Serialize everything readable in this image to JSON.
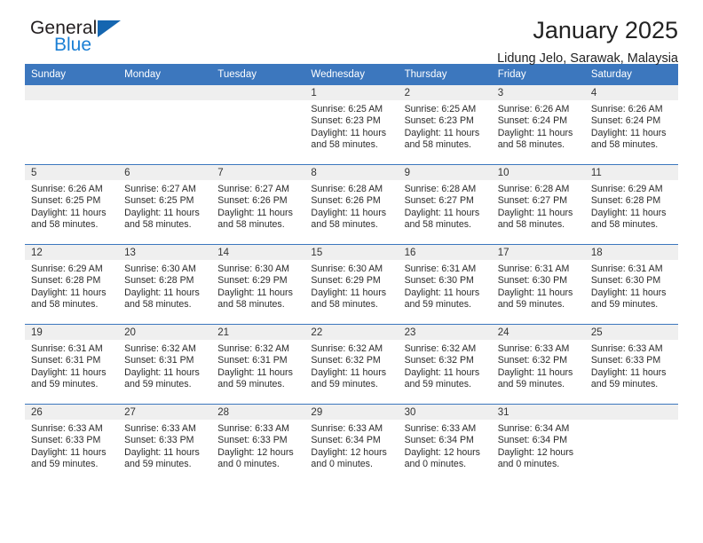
{
  "logo": {
    "word_top": "General",
    "word_bottom": "Blue",
    "triangle_color": "#1566b0",
    "blue_color": "#1b7fd4"
  },
  "header": {
    "title": "January 2025",
    "subtitle": "Lidung Jelo, Sarawak, Malaysia"
  },
  "theme": {
    "header_blue": "#3c77be",
    "daynum_band": "#efefef",
    "text": "#222222"
  },
  "weekday_headers": [
    "Sunday",
    "Monday",
    "Tuesday",
    "Wednesday",
    "Thursday",
    "Friday",
    "Saturday"
  ],
  "labels": {
    "sunrise_prefix": "Sunrise:",
    "sunset_prefix": "Sunset:",
    "daylight_prefix": "Daylight:"
  },
  "weeks": [
    [
      {
        "day": "",
        "empty": true
      },
      {
        "day": "",
        "empty": true
      },
      {
        "day": "",
        "empty": true
      },
      {
        "day": "1",
        "sunrise": "Sunrise: 6:25 AM",
        "sunset": "Sunset: 6:23 PM",
        "daylight": "Daylight: 11 hours and 58 minutes."
      },
      {
        "day": "2",
        "sunrise": "Sunrise: 6:25 AM",
        "sunset": "Sunset: 6:23 PM",
        "daylight": "Daylight: 11 hours and 58 minutes."
      },
      {
        "day": "3",
        "sunrise": "Sunrise: 6:26 AM",
        "sunset": "Sunset: 6:24 PM",
        "daylight": "Daylight: 11 hours and 58 minutes."
      },
      {
        "day": "4",
        "sunrise": "Sunrise: 6:26 AM",
        "sunset": "Sunset: 6:24 PM",
        "daylight": "Daylight: 11 hours and 58 minutes."
      }
    ],
    [
      {
        "day": "5",
        "sunrise": "Sunrise: 6:26 AM",
        "sunset": "Sunset: 6:25 PM",
        "daylight": "Daylight: 11 hours and 58 minutes."
      },
      {
        "day": "6",
        "sunrise": "Sunrise: 6:27 AM",
        "sunset": "Sunset: 6:25 PM",
        "daylight": "Daylight: 11 hours and 58 minutes."
      },
      {
        "day": "7",
        "sunrise": "Sunrise: 6:27 AM",
        "sunset": "Sunset: 6:26 PM",
        "daylight": "Daylight: 11 hours and 58 minutes."
      },
      {
        "day": "8",
        "sunrise": "Sunrise: 6:28 AM",
        "sunset": "Sunset: 6:26 PM",
        "daylight": "Daylight: 11 hours and 58 minutes."
      },
      {
        "day": "9",
        "sunrise": "Sunrise: 6:28 AM",
        "sunset": "Sunset: 6:27 PM",
        "daylight": "Daylight: 11 hours and 58 minutes."
      },
      {
        "day": "10",
        "sunrise": "Sunrise: 6:28 AM",
        "sunset": "Sunset: 6:27 PM",
        "daylight": "Daylight: 11 hours and 58 minutes."
      },
      {
        "day": "11",
        "sunrise": "Sunrise: 6:29 AM",
        "sunset": "Sunset: 6:28 PM",
        "daylight": "Daylight: 11 hours and 58 minutes."
      }
    ],
    [
      {
        "day": "12",
        "sunrise": "Sunrise: 6:29 AM",
        "sunset": "Sunset: 6:28 PM",
        "daylight": "Daylight: 11 hours and 58 minutes."
      },
      {
        "day": "13",
        "sunrise": "Sunrise: 6:30 AM",
        "sunset": "Sunset: 6:28 PM",
        "daylight": "Daylight: 11 hours and 58 minutes."
      },
      {
        "day": "14",
        "sunrise": "Sunrise: 6:30 AM",
        "sunset": "Sunset: 6:29 PM",
        "daylight": "Daylight: 11 hours and 58 minutes."
      },
      {
        "day": "15",
        "sunrise": "Sunrise: 6:30 AM",
        "sunset": "Sunset: 6:29 PM",
        "daylight": "Daylight: 11 hours and 58 minutes."
      },
      {
        "day": "16",
        "sunrise": "Sunrise: 6:31 AM",
        "sunset": "Sunset: 6:30 PM",
        "daylight": "Daylight: 11 hours and 59 minutes."
      },
      {
        "day": "17",
        "sunrise": "Sunrise: 6:31 AM",
        "sunset": "Sunset: 6:30 PM",
        "daylight": "Daylight: 11 hours and 59 minutes."
      },
      {
        "day": "18",
        "sunrise": "Sunrise: 6:31 AM",
        "sunset": "Sunset: 6:30 PM",
        "daylight": "Daylight: 11 hours and 59 minutes."
      }
    ],
    [
      {
        "day": "19",
        "sunrise": "Sunrise: 6:31 AM",
        "sunset": "Sunset: 6:31 PM",
        "daylight": "Daylight: 11 hours and 59 minutes."
      },
      {
        "day": "20",
        "sunrise": "Sunrise: 6:32 AM",
        "sunset": "Sunset: 6:31 PM",
        "daylight": "Daylight: 11 hours and 59 minutes."
      },
      {
        "day": "21",
        "sunrise": "Sunrise: 6:32 AM",
        "sunset": "Sunset: 6:31 PM",
        "daylight": "Daylight: 11 hours and 59 minutes."
      },
      {
        "day": "22",
        "sunrise": "Sunrise: 6:32 AM",
        "sunset": "Sunset: 6:32 PM",
        "daylight": "Daylight: 11 hours and 59 minutes."
      },
      {
        "day": "23",
        "sunrise": "Sunrise: 6:32 AM",
        "sunset": "Sunset: 6:32 PM",
        "daylight": "Daylight: 11 hours and 59 minutes."
      },
      {
        "day": "24",
        "sunrise": "Sunrise: 6:33 AM",
        "sunset": "Sunset: 6:32 PM",
        "daylight": "Daylight: 11 hours and 59 minutes."
      },
      {
        "day": "25",
        "sunrise": "Sunrise: 6:33 AM",
        "sunset": "Sunset: 6:33 PM",
        "daylight": "Daylight: 11 hours and 59 minutes."
      }
    ],
    [
      {
        "day": "26",
        "sunrise": "Sunrise: 6:33 AM",
        "sunset": "Sunset: 6:33 PM",
        "daylight": "Daylight: 11 hours and 59 minutes."
      },
      {
        "day": "27",
        "sunrise": "Sunrise: 6:33 AM",
        "sunset": "Sunset: 6:33 PM",
        "daylight": "Daylight: 11 hours and 59 minutes."
      },
      {
        "day": "28",
        "sunrise": "Sunrise: 6:33 AM",
        "sunset": "Sunset: 6:33 PM",
        "daylight": "Daylight: 12 hours and 0 minutes."
      },
      {
        "day": "29",
        "sunrise": "Sunrise: 6:33 AM",
        "sunset": "Sunset: 6:34 PM",
        "daylight": "Daylight: 12 hours and 0 minutes."
      },
      {
        "day": "30",
        "sunrise": "Sunrise: 6:33 AM",
        "sunset": "Sunset: 6:34 PM",
        "daylight": "Daylight: 12 hours and 0 minutes."
      },
      {
        "day": "31",
        "sunrise": "Sunrise: 6:34 AM",
        "sunset": "Sunset: 6:34 PM",
        "daylight": "Daylight: 12 hours and 0 minutes."
      },
      {
        "day": "",
        "empty": true
      }
    ]
  ]
}
